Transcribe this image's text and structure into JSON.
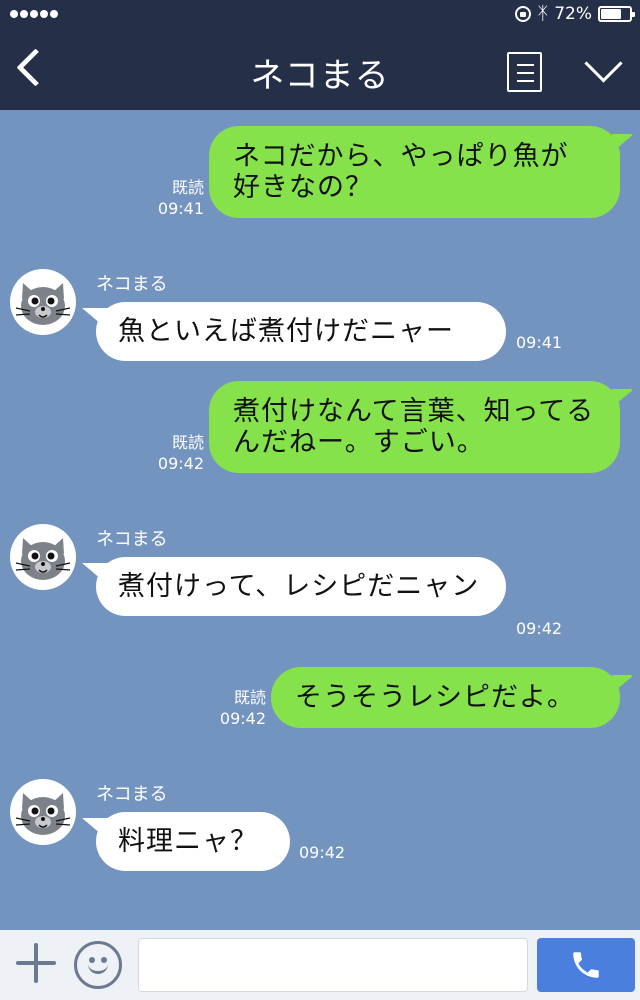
{
  "status_bar": {
    "signal_dots": 5,
    "orientation_lock_icon": "orientation-lock-icon",
    "bluetooth_icon": "bluetooth-icon",
    "battery_text": "72%",
    "battery_level": 0.72
  },
  "header": {
    "back_icon": "chevron-left-icon",
    "title": "ネコまる",
    "menu_icon": "list-menu-icon",
    "collapse_icon": "chevron-down-icon"
  },
  "messages": [
    {
      "dir": "out",
      "text": "ネコだから、やっぱり魚が好きなの？",
      "read": "既読",
      "time": "09:41"
    },
    {
      "dir": "in",
      "sender": "ネコまる",
      "text": "魚といえば煮付けだニャー",
      "time": "09:41"
    },
    {
      "dir": "out",
      "text": "煮付けなんて言葉、知ってるんだねー。すごい。",
      "read": "既読",
      "time": "09:42"
    },
    {
      "dir": "in",
      "sender": "ネコまる",
      "text": "煮付けって、レシピだニャン",
      "time": "09:42"
    },
    {
      "dir": "out",
      "text": "そうそうレシピだよ。",
      "read": "既読",
      "time": "09:42"
    },
    {
      "dir": "in",
      "sender": "ネコまる",
      "text": "料理ニャ？",
      "time": "09:42"
    }
  ],
  "input_bar": {
    "add_icon": "plus-icon",
    "emoji_icon": "smiley-icon",
    "message_value": "",
    "call_icon": "phone-icon"
  },
  "colors": {
    "header_bg": "#253048",
    "chat_bg": "#7494c0",
    "outgoing_bubble": "#85e24a",
    "incoming_bubble": "#ffffff",
    "call_button": "#4a7fe0"
  }
}
